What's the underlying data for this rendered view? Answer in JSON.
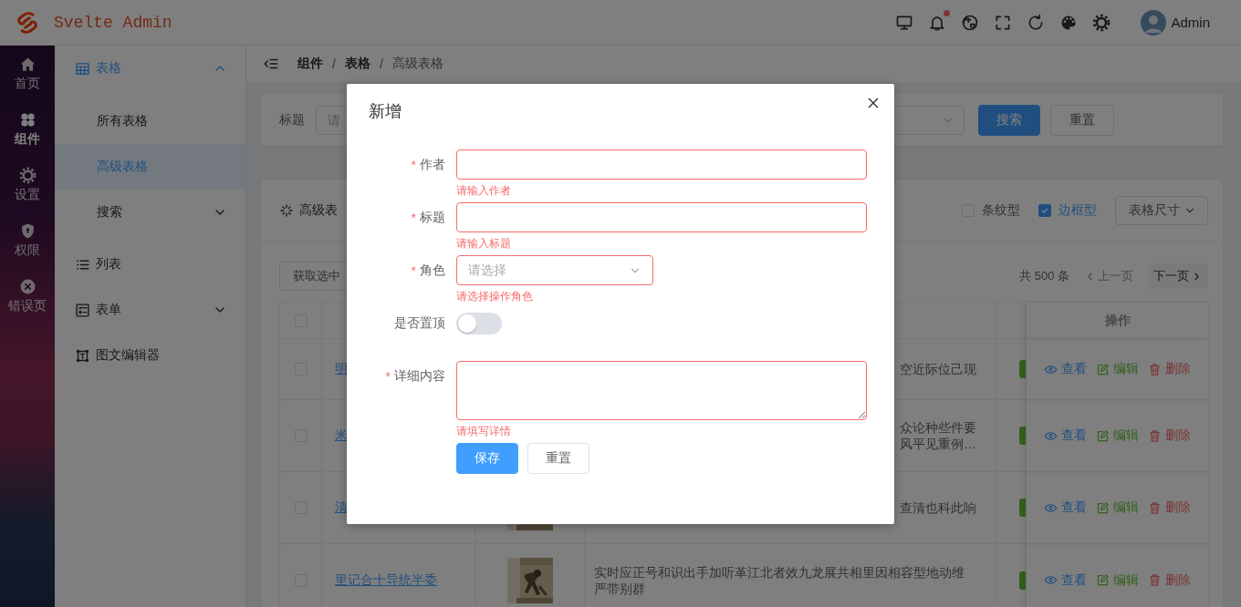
{
  "header": {
    "logo_text": "Svelte Admin",
    "notification_dot": true,
    "user": "Admin"
  },
  "rail": {
    "items": [
      {
        "label": "首页",
        "selected": false
      },
      {
        "label": "组件",
        "selected": true
      },
      {
        "label": "设置",
        "selected": false
      },
      {
        "label": "权限",
        "selected": false
      },
      {
        "label": "错误页",
        "selected": false
      }
    ]
  },
  "submenu": {
    "items": [
      {
        "label": "表格",
        "selected": true,
        "expanded": true,
        "children": [
          {
            "label": "所有表格",
            "selected": false
          },
          {
            "label": "高级表格",
            "selected": true
          },
          {
            "label": "搜索",
            "selected": false,
            "expanded": false
          }
        ]
      },
      {
        "label": "列表",
        "selected": false
      },
      {
        "label": "表单",
        "selected": false,
        "expanded": false
      },
      {
        "label": "图文编辑器",
        "selected": false
      }
    ]
  },
  "breadcrumb": [
    {
      "label": "组件",
      "kind": "link"
    },
    {
      "label": "/",
      "kind": "separator"
    },
    {
      "label": "表格",
      "kind": "link"
    },
    {
      "label": "/",
      "kind": "separator"
    },
    {
      "label": "高级表格",
      "kind": "current"
    }
  ],
  "search_panel": {
    "label": "标题",
    "placeholder": "请",
    "buttons": [
      {
        "label": "搜索",
        "kind": "primary"
      },
      {
        "label": "重置",
        "kind": "default"
      }
    ]
  },
  "table_card": {
    "title": "高级表",
    "options": [
      {
        "label": "条纹型",
        "checked": false
      },
      {
        "label": "边框型",
        "checked": true
      }
    ],
    "size_button": "表格尺寸",
    "toolbar_button": "获取选中",
    "pagination": {
      "total": "共 500 条",
      "prev": {
        "label": "上一页",
        "disabled": true
      },
      "next": {
        "label": "下一页",
        "disabled": false
      }
    },
    "table": {
      "header_checked": false,
      "action_column": "操作",
      "rows": [
        {
          "kind": "covered",
          "checked": false,
          "title": "明",
          "description": [
            "空近际位己现"
          ],
          "actions": [
            "查看",
            "编辑",
            "删除"
          ]
        },
        {
          "kind": "covered",
          "checked": false,
          "title": "米",
          "description": [
            "众论种些件要",
            "风平见重例…"
          ],
          "actions": [
            "查看",
            "编辑",
            "删除"
          ]
        },
        {
          "kind": "covered",
          "checked": false,
          "title": "清",
          "image": {
            "kind": "picture"
          },
          "description": [
            "查清也科此响"
          ],
          "actions": [
            "查看",
            "编辑",
            "删除"
          ]
        },
        {
          "kind": "full",
          "checked": false,
          "title": "里记合十导统半委",
          "image": {
            "kind": "picture"
          },
          "description": [
            "实时应正号和识出手加听革江北者效九龙展共相里因相容型地动维严带别群"
          ],
          "actions": [
            "查看",
            "编辑",
            "删除"
          ]
        }
      ]
    }
  },
  "modal": {
    "title": "新增",
    "fields": [
      {
        "kind": "input",
        "label": "作者",
        "required_mark": "*",
        "error": "请输入作者"
      },
      {
        "kind": "input",
        "label": "标题",
        "required_mark": "*",
        "error": "请输入标题"
      },
      {
        "kind": "select",
        "label": "角色",
        "required_mark": "*",
        "placeholder": "请选择",
        "error": "请选择操作角色"
      },
      {
        "kind": "switch",
        "label": "是否置顶",
        "on": false
      },
      {
        "kind": "textarea",
        "label": "详细内容",
        "required_mark": "*",
        "error": "请填写详情"
      }
    ],
    "buttons": [
      {
        "label": "保存",
        "kind": "primary"
      },
      {
        "label": "重置",
        "kind": "default"
      }
    ]
  }
}
